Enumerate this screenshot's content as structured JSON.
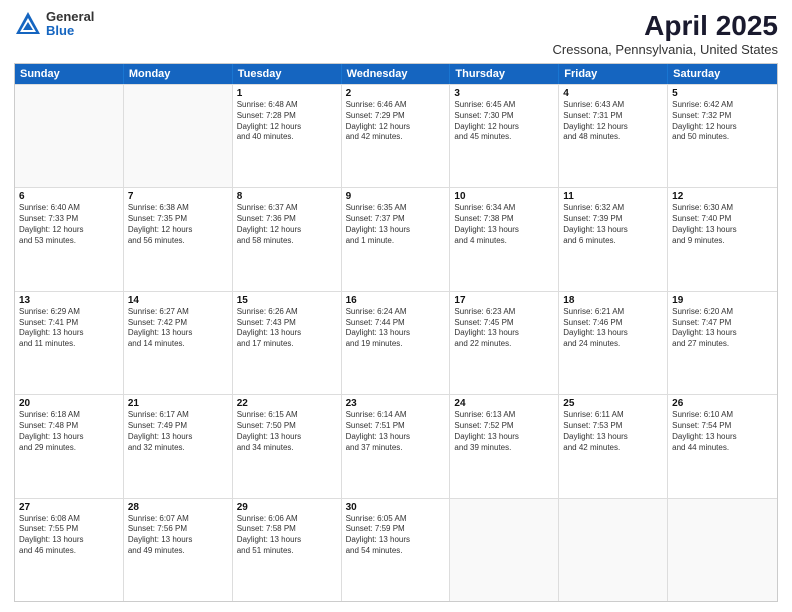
{
  "logo": {
    "general": "General",
    "blue": "Blue"
  },
  "title": "April 2025",
  "location": "Cressona, Pennsylvania, United States",
  "days_header": [
    "Sunday",
    "Monday",
    "Tuesday",
    "Wednesday",
    "Thursday",
    "Friday",
    "Saturday"
  ],
  "weeks": [
    [
      {
        "day": "",
        "lines": []
      },
      {
        "day": "",
        "lines": []
      },
      {
        "day": "1",
        "lines": [
          "Sunrise: 6:48 AM",
          "Sunset: 7:28 PM",
          "Daylight: 12 hours",
          "and 40 minutes."
        ]
      },
      {
        "day": "2",
        "lines": [
          "Sunrise: 6:46 AM",
          "Sunset: 7:29 PM",
          "Daylight: 12 hours",
          "and 42 minutes."
        ]
      },
      {
        "day": "3",
        "lines": [
          "Sunrise: 6:45 AM",
          "Sunset: 7:30 PM",
          "Daylight: 12 hours",
          "and 45 minutes."
        ]
      },
      {
        "day": "4",
        "lines": [
          "Sunrise: 6:43 AM",
          "Sunset: 7:31 PM",
          "Daylight: 12 hours",
          "and 48 minutes."
        ]
      },
      {
        "day": "5",
        "lines": [
          "Sunrise: 6:42 AM",
          "Sunset: 7:32 PM",
          "Daylight: 12 hours",
          "and 50 minutes."
        ]
      }
    ],
    [
      {
        "day": "6",
        "lines": [
          "Sunrise: 6:40 AM",
          "Sunset: 7:33 PM",
          "Daylight: 12 hours",
          "and 53 minutes."
        ]
      },
      {
        "day": "7",
        "lines": [
          "Sunrise: 6:38 AM",
          "Sunset: 7:35 PM",
          "Daylight: 12 hours",
          "and 56 minutes."
        ]
      },
      {
        "day": "8",
        "lines": [
          "Sunrise: 6:37 AM",
          "Sunset: 7:36 PM",
          "Daylight: 12 hours",
          "and 58 minutes."
        ]
      },
      {
        "day": "9",
        "lines": [
          "Sunrise: 6:35 AM",
          "Sunset: 7:37 PM",
          "Daylight: 13 hours",
          "and 1 minute."
        ]
      },
      {
        "day": "10",
        "lines": [
          "Sunrise: 6:34 AM",
          "Sunset: 7:38 PM",
          "Daylight: 13 hours",
          "and 4 minutes."
        ]
      },
      {
        "day": "11",
        "lines": [
          "Sunrise: 6:32 AM",
          "Sunset: 7:39 PM",
          "Daylight: 13 hours",
          "and 6 minutes."
        ]
      },
      {
        "day": "12",
        "lines": [
          "Sunrise: 6:30 AM",
          "Sunset: 7:40 PM",
          "Daylight: 13 hours",
          "and 9 minutes."
        ]
      }
    ],
    [
      {
        "day": "13",
        "lines": [
          "Sunrise: 6:29 AM",
          "Sunset: 7:41 PM",
          "Daylight: 13 hours",
          "and 11 minutes."
        ]
      },
      {
        "day": "14",
        "lines": [
          "Sunrise: 6:27 AM",
          "Sunset: 7:42 PM",
          "Daylight: 13 hours",
          "and 14 minutes."
        ]
      },
      {
        "day": "15",
        "lines": [
          "Sunrise: 6:26 AM",
          "Sunset: 7:43 PM",
          "Daylight: 13 hours",
          "and 17 minutes."
        ]
      },
      {
        "day": "16",
        "lines": [
          "Sunrise: 6:24 AM",
          "Sunset: 7:44 PM",
          "Daylight: 13 hours",
          "and 19 minutes."
        ]
      },
      {
        "day": "17",
        "lines": [
          "Sunrise: 6:23 AM",
          "Sunset: 7:45 PM",
          "Daylight: 13 hours",
          "and 22 minutes."
        ]
      },
      {
        "day": "18",
        "lines": [
          "Sunrise: 6:21 AM",
          "Sunset: 7:46 PM",
          "Daylight: 13 hours",
          "and 24 minutes."
        ]
      },
      {
        "day": "19",
        "lines": [
          "Sunrise: 6:20 AM",
          "Sunset: 7:47 PM",
          "Daylight: 13 hours",
          "and 27 minutes."
        ]
      }
    ],
    [
      {
        "day": "20",
        "lines": [
          "Sunrise: 6:18 AM",
          "Sunset: 7:48 PM",
          "Daylight: 13 hours",
          "and 29 minutes."
        ]
      },
      {
        "day": "21",
        "lines": [
          "Sunrise: 6:17 AM",
          "Sunset: 7:49 PM",
          "Daylight: 13 hours",
          "and 32 minutes."
        ]
      },
      {
        "day": "22",
        "lines": [
          "Sunrise: 6:15 AM",
          "Sunset: 7:50 PM",
          "Daylight: 13 hours",
          "and 34 minutes."
        ]
      },
      {
        "day": "23",
        "lines": [
          "Sunrise: 6:14 AM",
          "Sunset: 7:51 PM",
          "Daylight: 13 hours",
          "and 37 minutes."
        ]
      },
      {
        "day": "24",
        "lines": [
          "Sunrise: 6:13 AM",
          "Sunset: 7:52 PM",
          "Daylight: 13 hours",
          "and 39 minutes."
        ]
      },
      {
        "day": "25",
        "lines": [
          "Sunrise: 6:11 AM",
          "Sunset: 7:53 PM",
          "Daylight: 13 hours",
          "and 42 minutes."
        ]
      },
      {
        "day": "26",
        "lines": [
          "Sunrise: 6:10 AM",
          "Sunset: 7:54 PM",
          "Daylight: 13 hours",
          "and 44 minutes."
        ]
      }
    ],
    [
      {
        "day": "27",
        "lines": [
          "Sunrise: 6:08 AM",
          "Sunset: 7:55 PM",
          "Daylight: 13 hours",
          "and 46 minutes."
        ]
      },
      {
        "day": "28",
        "lines": [
          "Sunrise: 6:07 AM",
          "Sunset: 7:56 PM",
          "Daylight: 13 hours",
          "and 49 minutes."
        ]
      },
      {
        "day": "29",
        "lines": [
          "Sunrise: 6:06 AM",
          "Sunset: 7:58 PM",
          "Daylight: 13 hours",
          "and 51 minutes."
        ]
      },
      {
        "day": "30",
        "lines": [
          "Sunrise: 6:05 AM",
          "Sunset: 7:59 PM",
          "Daylight: 13 hours",
          "and 54 minutes."
        ]
      },
      {
        "day": "",
        "lines": []
      },
      {
        "day": "",
        "lines": []
      },
      {
        "day": "",
        "lines": []
      }
    ]
  ]
}
